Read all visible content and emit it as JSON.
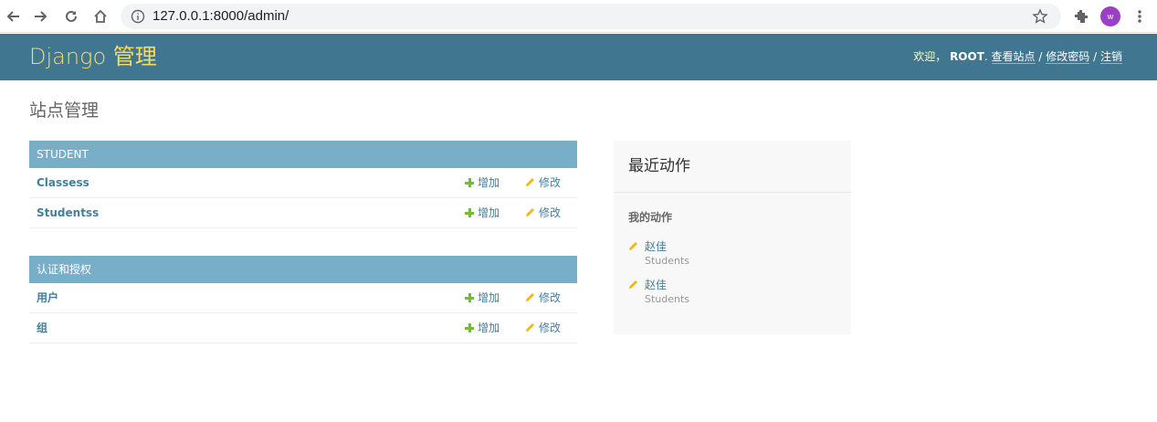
{
  "browser": {
    "url": "127.0.0.1:8000/admin/",
    "avatar_letter": "w"
  },
  "header": {
    "branding": "Django 管理",
    "welcome": "欢迎，",
    "username": "ROOT",
    "period": ".",
    "view_site": "查看站点",
    "change_password": "修改密码",
    "logout": "注销",
    "separator": "/"
  },
  "page_title": "站点管理",
  "modules": [
    {
      "caption": "STUDENT",
      "rows": [
        {
          "name": "Classess",
          "add": "增加",
          "change": "修改"
        },
        {
          "name": "Studentss",
          "add": "增加",
          "change": "修改"
        }
      ]
    },
    {
      "caption": "认证和授权",
      "rows": [
        {
          "name": "用户",
          "add": "增加",
          "change": "修改"
        },
        {
          "name": "组",
          "add": "增加",
          "change": "修改"
        }
      ]
    }
  ],
  "recent_actions": {
    "title": "最近动作",
    "subtitle": "我的动作",
    "items": [
      {
        "object": "赵佳",
        "type": "Students"
      },
      {
        "object": "赵佳",
        "type": "Students"
      }
    ]
  },
  "colors": {
    "header_bg": "#417690",
    "branding": "#f5dd5d",
    "module_caption_bg": "#79aec8",
    "link": "#447e9b",
    "add_icon": "#70bf2b",
    "change_icon": "#efb80b"
  },
  "icons": [
    "back-arrow-icon",
    "forward-arrow-icon",
    "reload-icon",
    "home-icon",
    "info-icon",
    "star-icon",
    "extensions-icon",
    "menu-icon",
    "add-icon",
    "change-icon"
  ]
}
